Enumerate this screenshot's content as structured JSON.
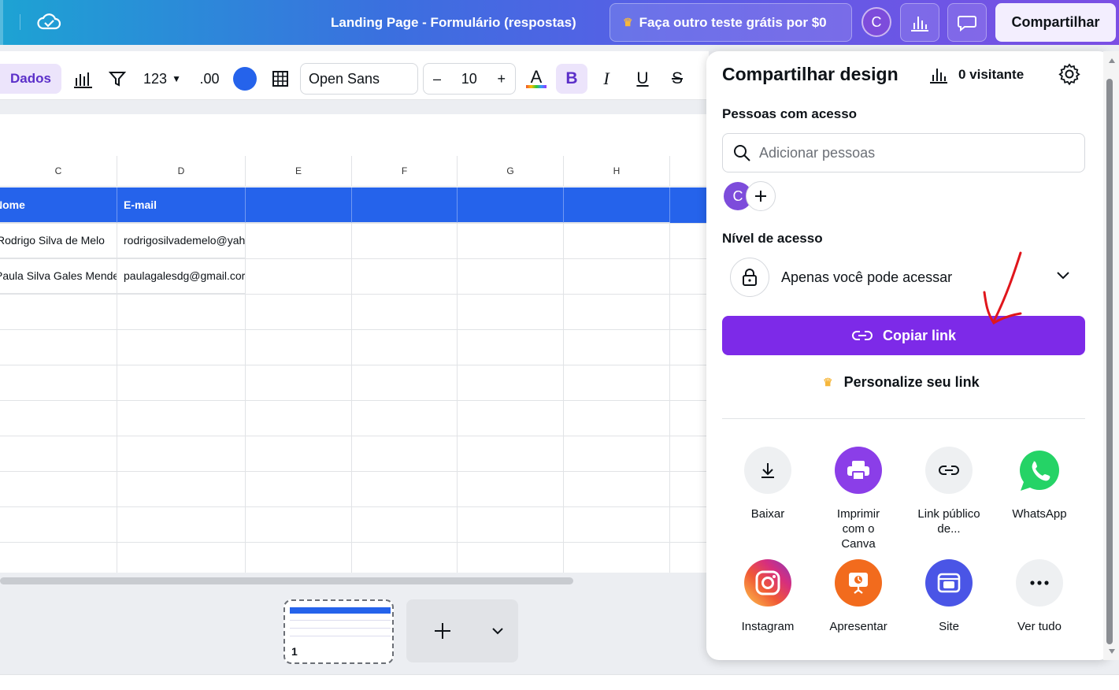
{
  "topbar": {
    "title": "Landing Page - Formulário (respostas)",
    "trial_label": "Faça outro teste grátis por $0",
    "avatar_initial": "C",
    "share_label": "Compartilhar"
  },
  "toolbar": {
    "data_tab": "Dados",
    "number_format": "123",
    "decimal_format": ".00",
    "font_name": "Open Sans",
    "font_size": "10",
    "minus": "–",
    "plus": "+",
    "bold": "B",
    "italic": "I",
    "underline": "U",
    "strike": "S",
    "cell_color": "#2563eb"
  },
  "sheet": {
    "columns": [
      "C",
      "D",
      "E",
      "F",
      "G",
      "H"
    ],
    "header_row": [
      "Nome",
      "E-mail"
    ],
    "rows": [
      [
        "Rodrigo  Silva de Melo",
        "rodrigosilvademelo@yah"
      ],
      [
        "Paula Silva Gales Mende",
        "paulagalesdg@gmail.cor"
      ]
    ],
    "page_number": "1"
  },
  "share_panel": {
    "title": "Compartilhar design",
    "visitors": "0 visitante",
    "people_label": "Pessoas com acesso",
    "search_placeholder": "Adicionar pessoas",
    "person_initial": "C",
    "access_label": "Nível de acesso",
    "access_value": "Apenas você pode acessar",
    "copy_link": "Copiar link",
    "personalize": "Personalize seu link",
    "options": [
      {
        "label": "Baixar",
        "icon": "download-icon"
      },
      {
        "label": "Imprimir com o Canva",
        "icon": "printer-icon"
      },
      {
        "label": "Link público de...",
        "icon": "link-icon"
      },
      {
        "label": "WhatsApp",
        "icon": "whatsapp-icon"
      },
      {
        "label": "Instagram",
        "icon": "instagram-icon"
      },
      {
        "label": "Apresentar",
        "icon": "present-icon"
      },
      {
        "label": "Site",
        "icon": "website-icon"
      },
      {
        "label": "Ver tudo",
        "icon": "more-icon"
      }
    ]
  },
  "colors": {
    "accent": "#7d2ae8",
    "header_blue": "#2563eb",
    "whatsapp": "#25d366",
    "present": "#f26b1d",
    "site": "#4a55e6"
  }
}
